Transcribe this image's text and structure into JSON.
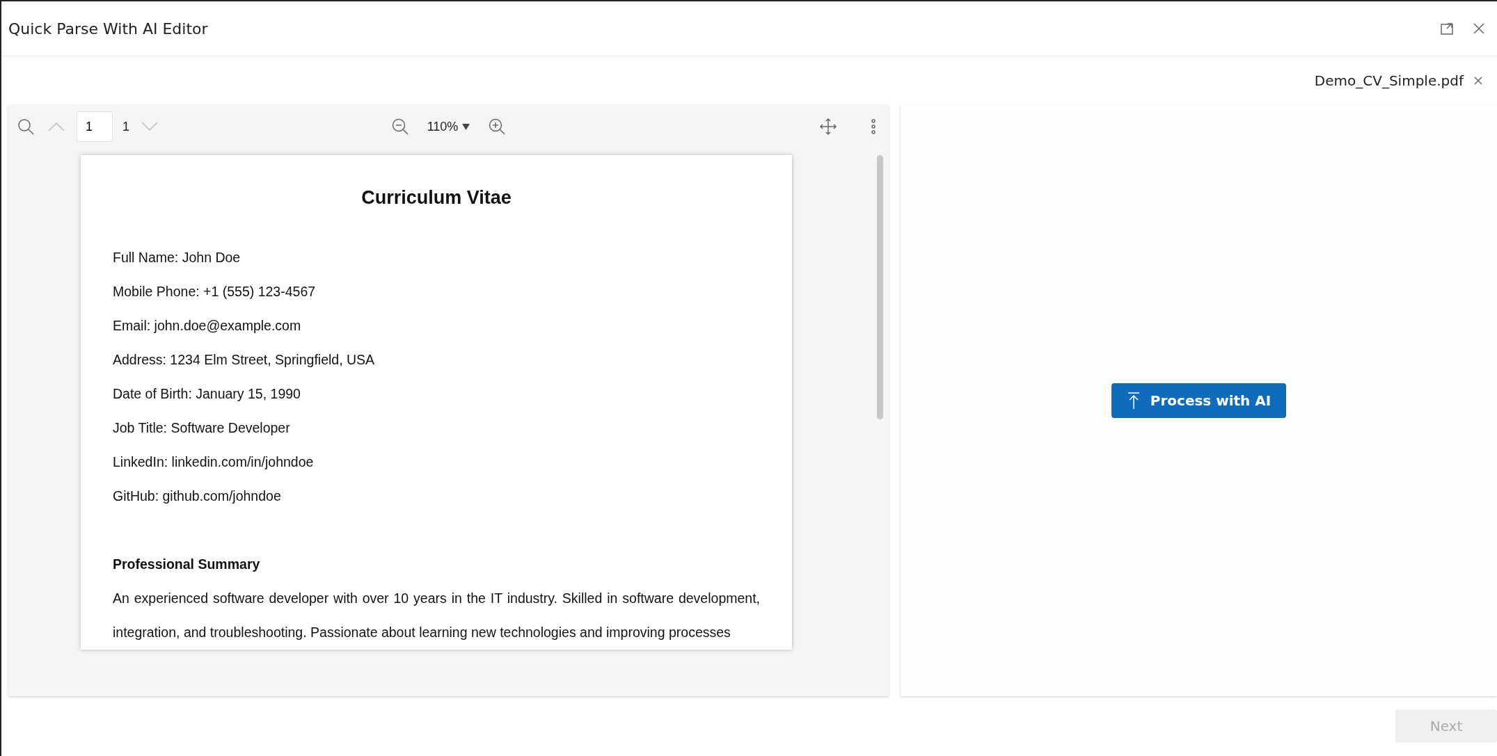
{
  "window": {
    "title": "Quick Parse With AI Editor"
  },
  "file_tab": {
    "name": "Demo_CV_Simple.pdf"
  },
  "viewer_toolbar": {
    "page_input": "1",
    "page_count": "1",
    "zoom": "110%"
  },
  "document": {
    "title": "Curriculum Vitae",
    "fields": [
      "Full Name: John Doe",
      "Mobile Phone: +1 (555) 123-4567",
      "Email: john.doe@example.com",
      "Address: 1234 Elm Street, Springfield, USA",
      "Date of Birth: January 15, 1990",
      "Job Title: Software Developer",
      "LinkedIn: linkedin.com/in/johndoe",
      "GitHub: github.com/johndoe"
    ],
    "sections": [
      {
        "heading": "Professional Summary",
        "paragraph": "An experienced software developer with over 10 years in the IT industry. Skilled in software development, integration, and troubleshooting. Passionate about learning new technologies and improving processes"
      }
    ]
  },
  "process_button": {
    "label": "Process with AI"
  },
  "next_button": {
    "label": "Next",
    "disabled": true
  }
}
